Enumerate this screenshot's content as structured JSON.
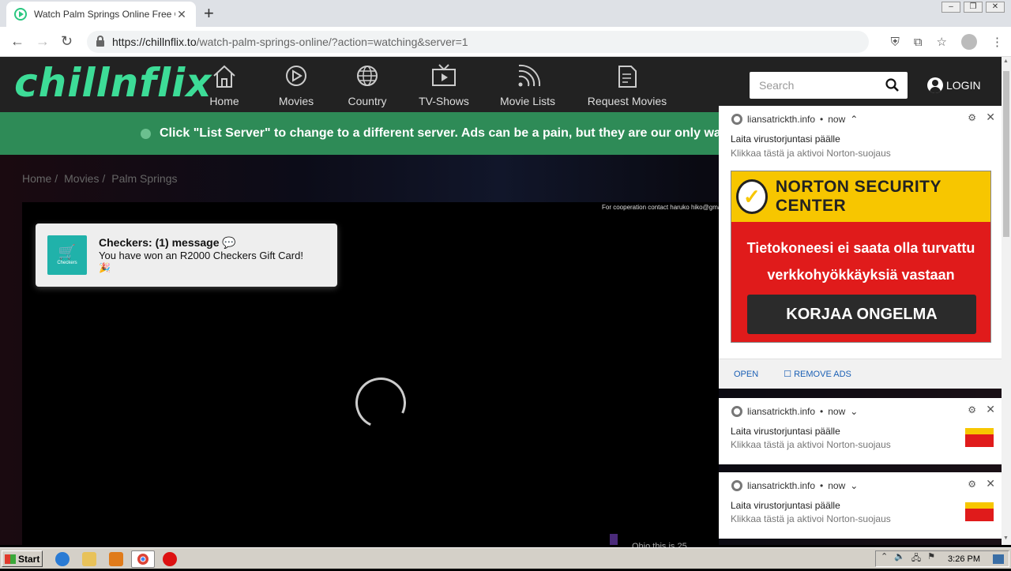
{
  "browser": {
    "tab_title": "Watch Palm Springs Online Free GoM",
    "tab_close": "✕",
    "newtab": "+",
    "url_host": "https://chillnflix.to",
    "url_path": "/watch-palm-springs-online/?action=watching&server=1"
  },
  "site": {
    "logo": "chillnflix",
    "nav": [
      {
        "label": "Home",
        "icon": "home-icon"
      },
      {
        "label": "Movies",
        "icon": "play-circle-icon"
      },
      {
        "label": "Country",
        "icon": "globe-icon"
      },
      {
        "label": "TV-Shows",
        "icon": "tv-icon"
      },
      {
        "label": "Movie Lists",
        "icon": "rss-icon"
      },
      {
        "label": "Request Movies",
        "icon": "request-icon"
      }
    ],
    "search_placeholder": "Search",
    "login_label": "LOGIN",
    "banner_text": "Click \"List Server\" to change to a different server. Ads can be a pain, but they are our only way"
  },
  "breadcrumb": [
    "Home /",
    "Movies /",
    "Palm Springs"
  ],
  "player": {
    "coop_text": "For cooperation contact haruko hiko@gmail",
    "bottom_text": "Ohio this is 25"
  },
  "checkers_popup": {
    "logo_label": "Checkers",
    "title": "Checkers: (1) message 💬",
    "message": "You have won an R2000 Checkers Gift Card!",
    "extra": "🎉"
  },
  "notifications": [
    {
      "site": "liansatrickth.info",
      "time": "now",
      "chevron": "⌃",
      "title": "Laita virustorjuntasi päälle",
      "subtitle": "Klikkaa tästä ja aktivoi Norton-suojaus",
      "banner_heading": "NORTON SECURITY CENTER",
      "banner_line1": "Tietokoneesi ei saata olla turvattu",
      "banner_line2": "verkkohyökkäyksiä vastaan",
      "banner_button": "KORJAA ONGELMA",
      "action_open": "OPEN",
      "action_remove": "☐ REMOVE ADS"
    },
    {
      "site": "liansatrickth.info",
      "time": "now",
      "chevron": "⌄",
      "title": "Laita virustorjuntasi päälle",
      "subtitle": "Klikkaa tästä ja aktivoi Norton-suojaus"
    },
    {
      "site": "liansatrickth.info",
      "time": "now",
      "chevron": "⌄",
      "title": "Laita virustorjuntasi päälle",
      "subtitle": "Klikkaa tästä ja aktivoi Norton-suojaus"
    }
  ],
  "taskbar": {
    "start_label": "Start",
    "clock": "3:26 PM"
  },
  "colors": {
    "brand": "#3ddc97",
    "banner_green": "#2e8b57",
    "norton_yellow": "#f7c600",
    "norton_red": "#e01b1b"
  }
}
